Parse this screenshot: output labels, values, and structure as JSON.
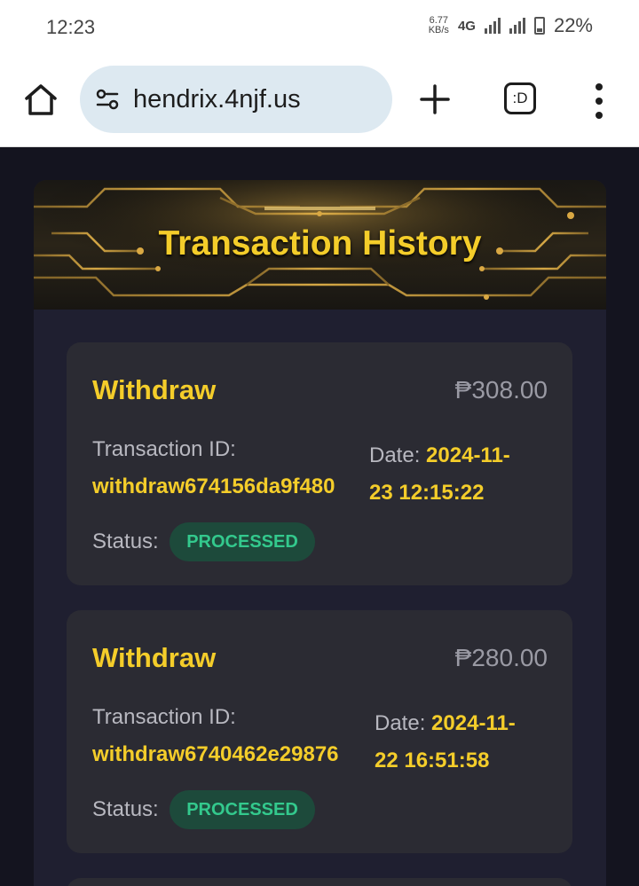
{
  "status_bar": {
    "time": "12:23",
    "net_speed_value": "6.77",
    "net_speed_unit": "KB/s",
    "network": "4G",
    "battery": "22%"
  },
  "browser": {
    "url": "hendrix.4njf.us",
    "tabs_label": ":D"
  },
  "page": {
    "title": "Transaction History",
    "transactions": [
      {
        "type": "Withdraw",
        "amount": "₱308.00",
        "id_label": "Transaction ID:",
        "id": "withdraw674156da9f480",
        "date_label": "Date:",
        "date_line1": "2024-11-",
        "date_line2": "23 12:15:22",
        "status_label": "Status:",
        "status": "PROCESSED"
      },
      {
        "type": "Withdraw",
        "amount": "₱280.00",
        "id_label": "Transaction ID:",
        "id": "withdraw6740462e29876",
        "date_label": "Date:",
        "date_line1": "2024-11-",
        "date_line2": "22 16:51:58",
        "status_label": "Status:",
        "status": "PROCESSED"
      }
    ]
  },
  "colors": {
    "accent": "#f4cd2a",
    "status_text": "#33c98d",
    "status_bg": "#1d4a3b",
    "card_bg": "#2b2b33"
  }
}
